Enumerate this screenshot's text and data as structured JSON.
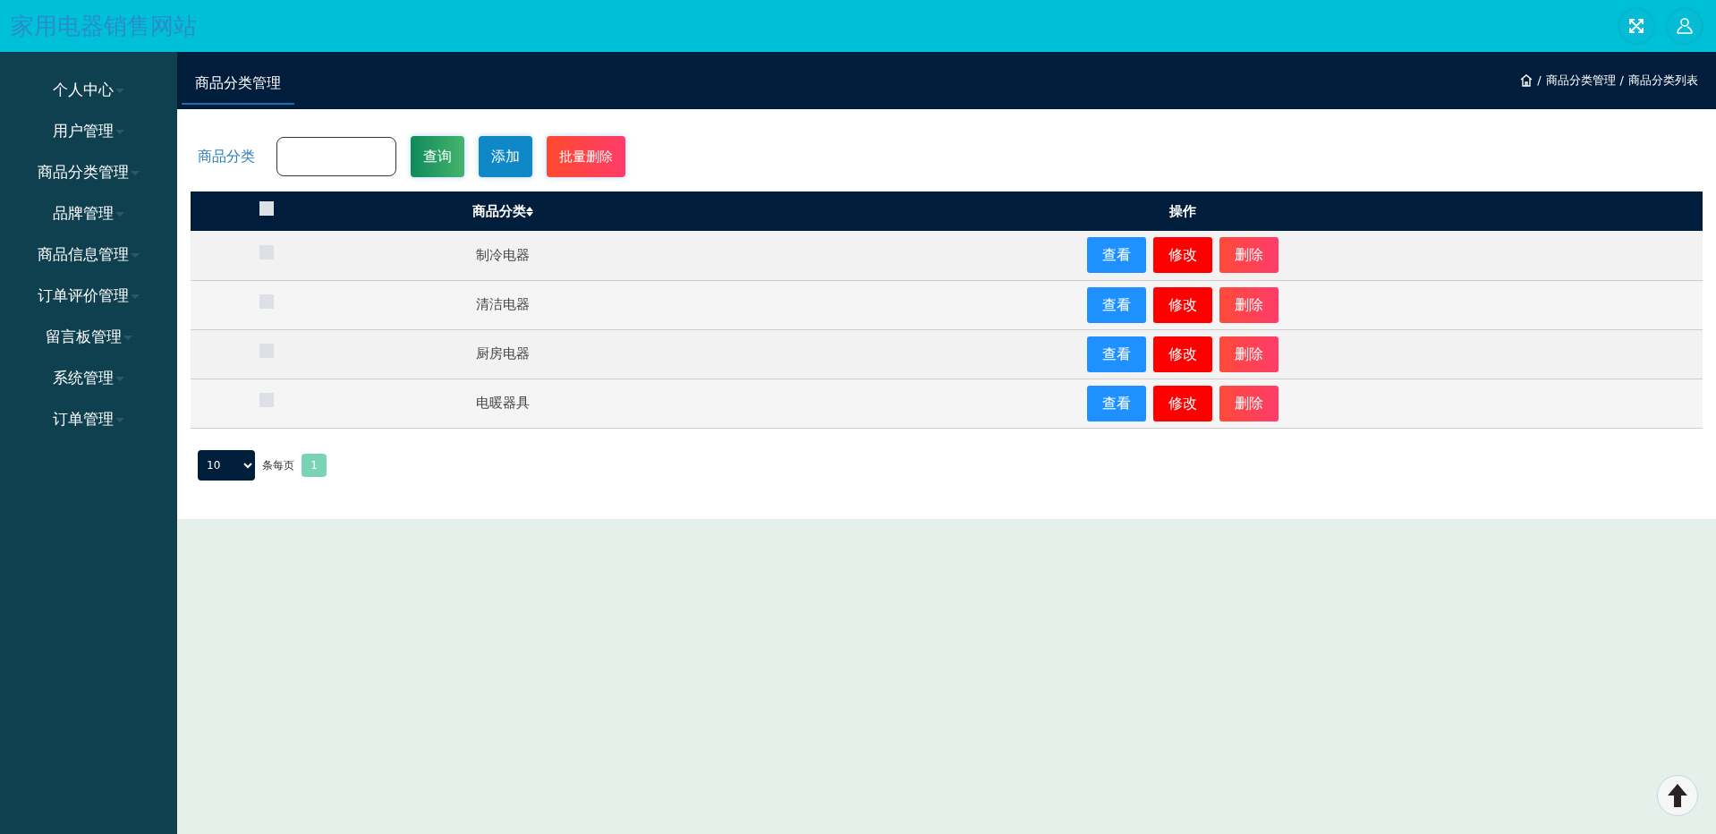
{
  "header": {
    "title": "家用电器销售网站"
  },
  "sidebar": {
    "items": [
      {
        "label": "个人中心",
        "expanded": false
      },
      {
        "label": "用户管理",
        "expanded": false
      },
      {
        "label": "商品分类管理",
        "expanded": false
      },
      {
        "label": "品牌管理",
        "expanded": false
      },
      {
        "label": "商品信息管理",
        "expanded": false
      },
      {
        "label": "订单评价管理",
        "expanded": false
      },
      {
        "label": "留言板管理",
        "expanded": false
      },
      {
        "label": "系统管理",
        "expanded": false
      },
      {
        "label": "订单管理",
        "expanded": false
      }
    ]
  },
  "tabs": [
    {
      "label": "商品分类管理",
      "selected": true
    }
  ],
  "breadcrumb": [
    {
      "separator": "/",
      "label": "商品分类管理"
    },
    {
      "separator": "/",
      "label": "商品分类列表"
    }
  ],
  "search": {
    "label": "商品分类"
  },
  "toolbar_buttons": [
    {
      "label": "查询",
      "kind": "search"
    },
    {
      "label": "添加",
      "kind": "add"
    },
    {
      "label": "批量删除",
      "kind": "delete"
    }
  ],
  "table": {
    "columns": [
      "商品分类",
      "操作"
    ],
    "select_all": false,
    "rows": [
      {
        "checked": false,
        "category": "制冷电器",
        "actions": [
          "查看",
          "修改",
          "删除"
        ]
      },
      {
        "checked": false,
        "category": "清洁电器",
        "actions": [
          "查看",
          "修改",
          "删除"
        ]
      },
      {
        "checked": false,
        "category": "厨房电器",
        "actions": [
          "查看",
          "修改",
          "删除"
        ]
      },
      {
        "checked": false,
        "category": "电暖器具",
        "actions": [
          "查看",
          "修改",
          "删除"
        ]
      }
    ]
  },
  "pagination": {
    "page_size": "10",
    "per_page_label": "条每页",
    "pages": [
      {
        "label": "1",
        "selected": true
      }
    ]
  }
}
